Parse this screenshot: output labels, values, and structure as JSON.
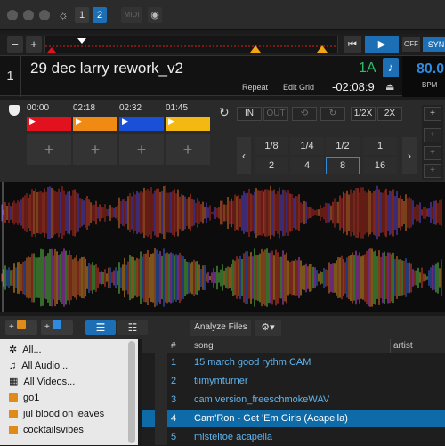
{
  "toolbar": {
    "deck1_label": "1",
    "deck2_label": "2",
    "midi_label": "MIDI"
  },
  "transport": {
    "minus": "−",
    "plus": "+",
    "off_label": "OFF",
    "sync_label": "SYN"
  },
  "deck": {
    "number": "1",
    "title": "29 dec larry rework_v2",
    "key": "1A",
    "repeat_label": "Repeat",
    "edit_grid_label": "Edit Grid",
    "remaining_time": "-02:08:9",
    "bpm_value": "80.0",
    "bpm_label": "BPM"
  },
  "cues": [
    {
      "time": "00:00",
      "color": "#e1121d"
    },
    {
      "time": "02:18",
      "color": "#f08a12"
    },
    {
      "time": "02:32",
      "color": "#1a4fd8"
    },
    {
      "time": "01:45",
      "color": "#f3b812"
    }
  ],
  "cue_add_label": "+",
  "loop": {
    "in_label": "IN",
    "out_label": "OUT",
    "half_label": "1/2X",
    "double_label": "2X",
    "row1": [
      "1/8",
      "1/4",
      "1/2",
      "1"
    ],
    "row2": [
      "2",
      "4",
      "8",
      "16"
    ],
    "selected": "8"
  },
  "library": {
    "analyze_label": "Analyze Files",
    "sidebar": [
      {
        "label": "All...",
        "icon": "gear-icon"
      },
      {
        "label": "All Audio...",
        "icon": "music-icon"
      },
      {
        "label": "All Videos...",
        "icon": "film-icon"
      },
      {
        "label": "go1",
        "icon": "crate-icon"
      },
      {
        "label": "jul blood on leaves",
        "icon": "crate-icon"
      },
      {
        "label": "cocktailsvibes",
        "icon": "crate-icon"
      }
    ],
    "columns": {
      "num": "#",
      "song": "song",
      "artist": "artist"
    },
    "tracks": [
      {
        "num": "1",
        "song": "15 march good rythm CAM"
      },
      {
        "num": "2",
        "song": "tiimymturner"
      },
      {
        "num": "3",
        "song": "cam version_freeschmokeWAV"
      },
      {
        "num": "4",
        "song": "Cam'Ron - Get 'Em Girls (Acapella)",
        "selected": true
      },
      {
        "num": "5",
        "song": "misteltoe acapella"
      }
    ]
  }
}
